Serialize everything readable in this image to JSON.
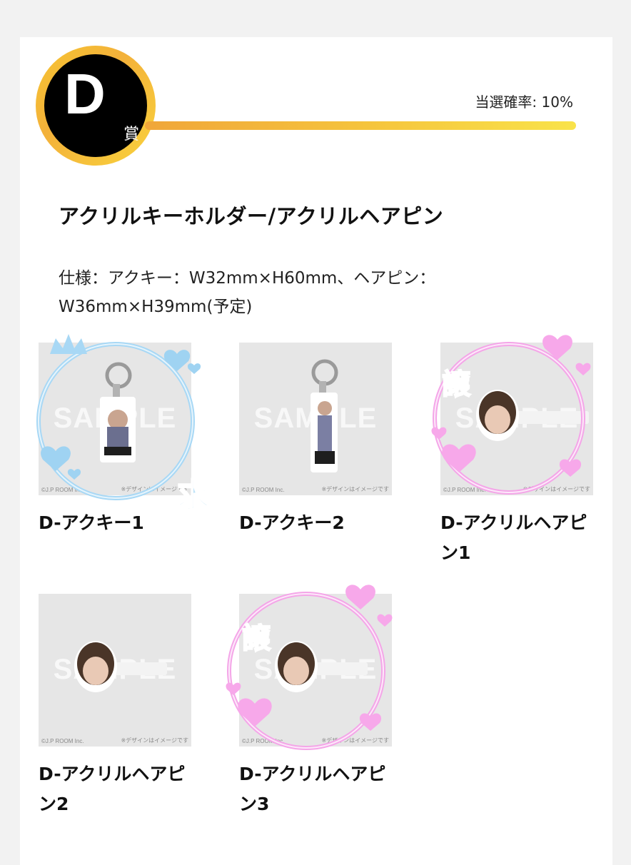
{
  "header": {
    "badge_letter": "D",
    "badge_prize": "賞",
    "odds": "当選確率: 10%"
  },
  "product": {
    "title": "アクリルキーホルダー/アクリルヘアピン",
    "spec_line1": "仕様：アクキー：W32mm×H60mm、ヘアピン：",
    "spec_line2": "W36mm×H39mm(予定)"
  },
  "thumb_text": {
    "sample": "SAMPLE",
    "copyright": "©J.P ROOM Inc.",
    "note": "※デザインはイメージです",
    "tag_brand": "© J.P ROOM Inc."
  },
  "items": [
    {
      "label": "D-アクキー1",
      "type": "keychain",
      "mark": "求"
    },
    {
      "label": "D-アクキー2",
      "type": "keychain",
      "mark": ""
    },
    {
      "label": "D-アクリルヘアピン1",
      "type": "hairpin",
      "mark": "譲"
    },
    {
      "label": "D-アクリルヘアピン2",
      "type": "hairpin",
      "mark": ""
    },
    {
      "label": "D-アクリルヘアピン3",
      "type": "hairpin",
      "mark": "譲"
    }
  ],
  "colors": {
    "gold": "#f5c33c",
    "want_frame": "#9fd3f2",
    "give_frame": "#f4a6e8"
  }
}
